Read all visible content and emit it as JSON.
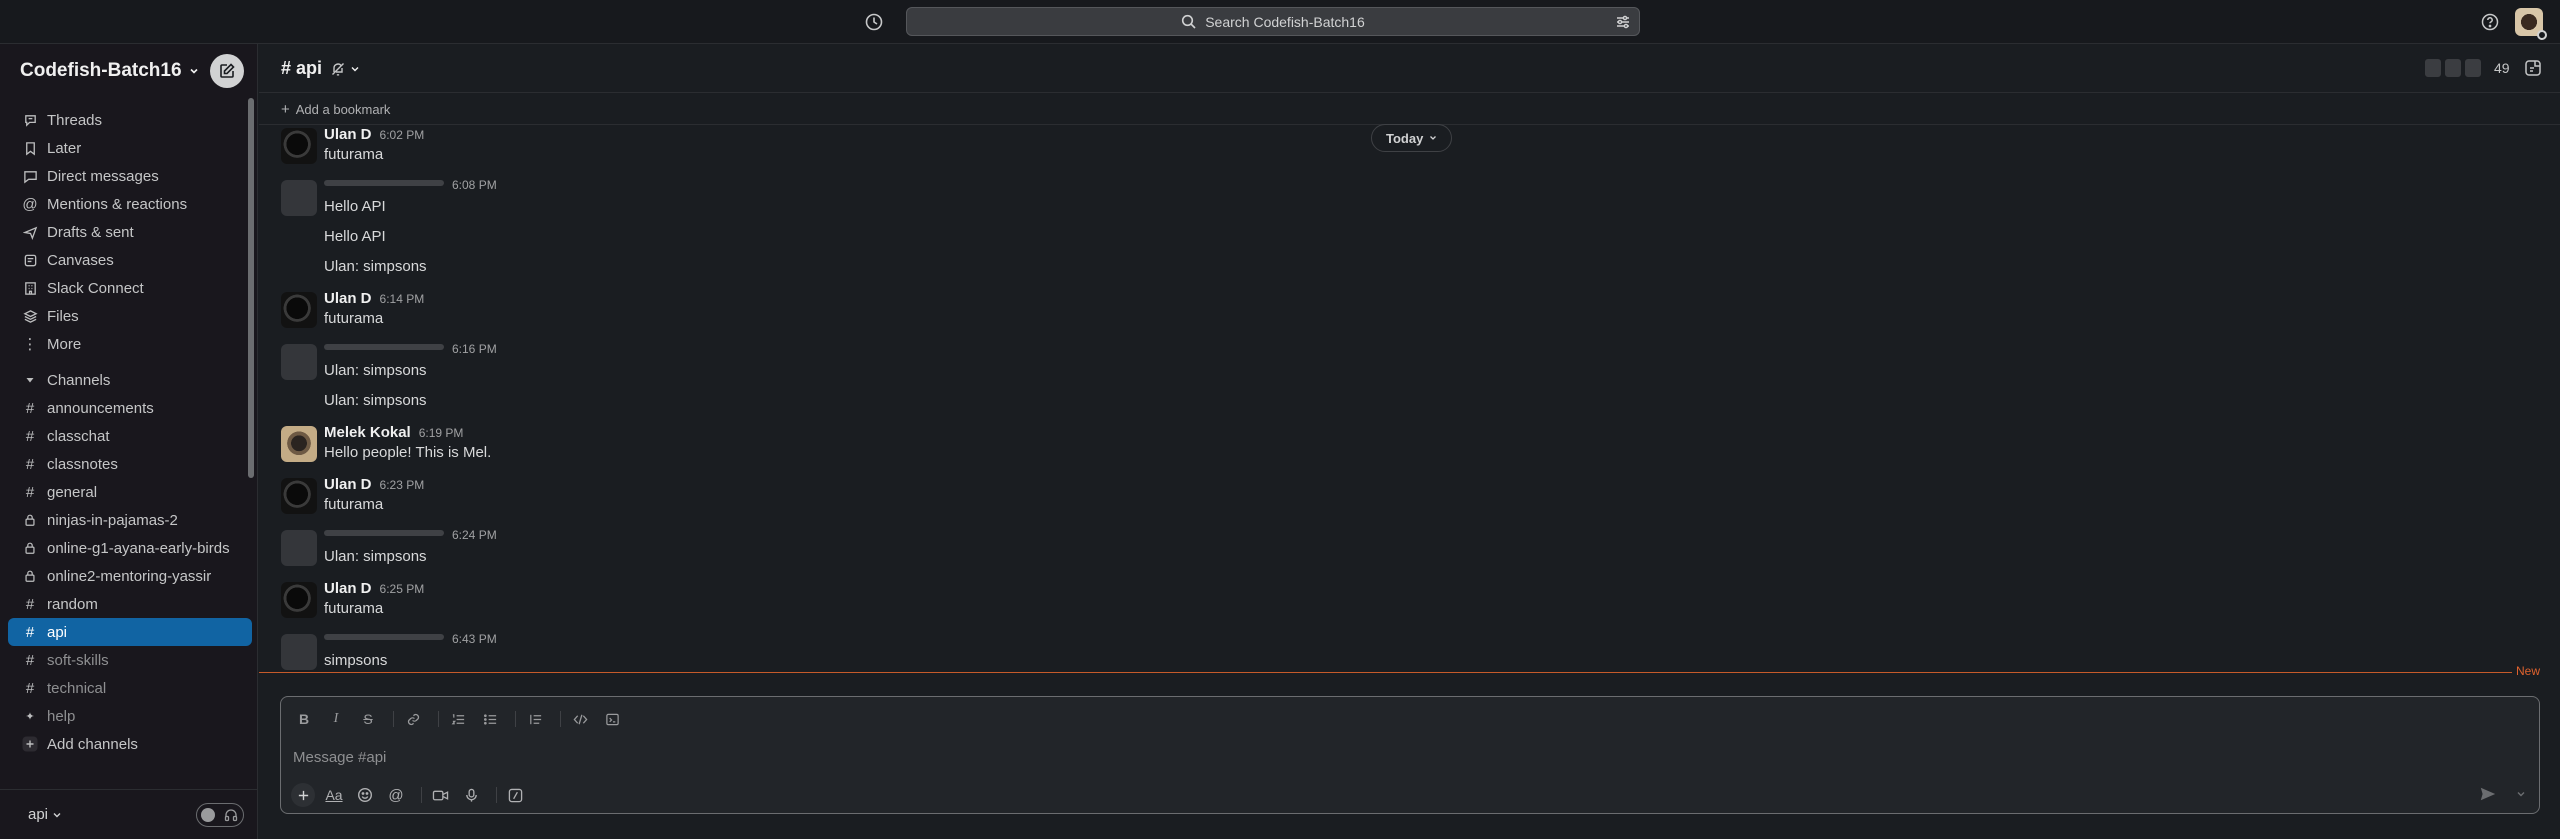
{
  "topbar": {
    "search_placeholder": "Search Codefish-Batch16"
  },
  "sidebar": {
    "workspace_name": "Codefish-Batch16",
    "nav": [
      {
        "label": "Threads"
      },
      {
        "label": "Later"
      },
      {
        "label": "Direct messages"
      },
      {
        "label": "Mentions & reactions"
      },
      {
        "label": "Drafts & sent"
      },
      {
        "label": "Canvases"
      },
      {
        "label": "Slack Connect"
      },
      {
        "label": "Files"
      },
      {
        "label": "More"
      }
    ],
    "channels_header": "Channels",
    "channels": [
      {
        "label": "announcements"
      },
      {
        "label": "classchat"
      },
      {
        "label": "classnotes"
      },
      {
        "label": "general"
      },
      {
        "label": "ninjas-in-pajamas-2"
      },
      {
        "label": "online-g1-ayana-early-birds"
      },
      {
        "label": "online2-mentoring-yassir"
      },
      {
        "label": "random"
      },
      {
        "label": "api"
      },
      {
        "label": "soft-skills"
      },
      {
        "label": "technical"
      },
      {
        "label": "help"
      }
    ],
    "add_channels": "Add channels",
    "footer_label": "api"
  },
  "header": {
    "channel_name": "# api",
    "member_count": "49",
    "add_bookmark": "Add a bookmark"
  },
  "today_label": "Today",
  "new_label": "New",
  "messages": [
    {
      "author": "Ulan D",
      "time": "6:02 PM",
      "lines": [
        "futurama"
      ]
    },
    {
      "author": "",
      "time": "6:08 PM",
      "lines": [
        "Hello API",
        "Hello API",
        "Ulan: simpsons"
      ]
    },
    {
      "author": "Ulan D",
      "time": "6:14 PM",
      "lines": [
        "futurama"
      ]
    },
    {
      "author": "",
      "time": "6:16 PM",
      "lines": [
        "Ulan: simpsons",
        "Ulan: simpsons"
      ]
    },
    {
      "author": "Melek Kokal",
      "time": "6:19 PM",
      "lines": [
        "Hello people! This is Mel."
      ]
    },
    {
      "author": "Ulan D",
      "time": "6:23 PM",
      "lines": [
        "futurama"
      ]
    },
    {
      "author": "",
      "time": "6:24 PM",
      "lines": [
        "Ulan: simpsons"
      ]
    },
    {
      "author": "Ulan D",
      "time": "6:25 PM",
      "lines": [
        "futurama"
      ]
    },
    {
      "author": "",
      "time": "6:43 PM",
      "lines": [
        "simpsons"
      ]
    }
  ],
  "composer": {
    "placeholder": "Message #api"
  },
  "colors": {
    "active": "#1164a3",
    "new_divider": "#e0622e"
  }
}
